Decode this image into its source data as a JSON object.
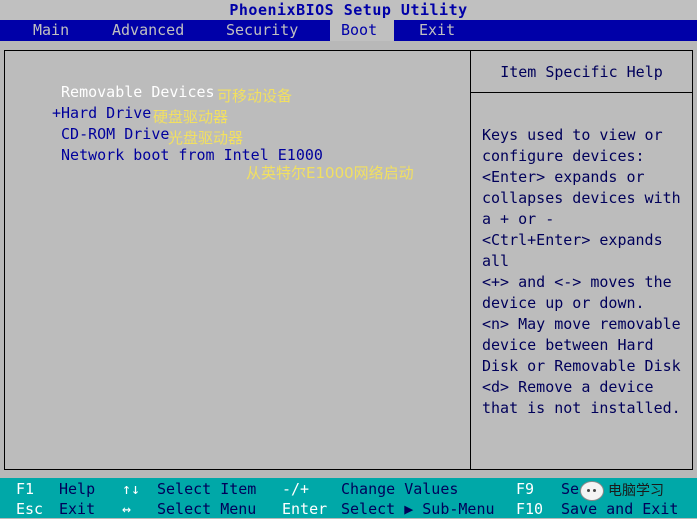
{
  "title": "PhoenixBIOS Setup Utility",
  "menu": [
    {
      "label": "Main"
    },
    {
      "label": "Advanced"
    },
    {
      "label": "Security"
    },
    {
      "label": "Boot"
    },
    {
      "label": "Exit"
    }
  ],
  "active_menu": "Boot",
  "boot_items": [
    {
      "label": " Removable Devices",
      "annotation": "可移动设备"
    },
    {
      "label": "+Hard Drive",
      "annotation": "硬盘驱动器"
    },
    {
      "label": " CD-ROM Drive",
      "annotation": "光盘驱动器"
    },
    {
      "label": " Network boot from Intel E1000",
      "annotation": "从英特尔E1000网络启动"
    }
  ],
  "help": {
    "title": "Item Specific Help",
    "lines": [
      "Keys used to view or",
      "configure devices:",
      "<Enter> expands or",
      "collapses devices with",
      "a + or -",
      "<Ctrl+Enter> expands",
      "all",
      "<+> and <-> moves the",
      "device up or down.",
      "<n> May move removable",
      "device between Hard",
      "Disk or Removable Disk",
      "<d> Remove a device",
      "that is not installed."
    ]
  },
  "status": {
    "row1": [
      {
        "key": "F1",
        "desc": "Help"
      },
      {
        "key": "↑↓",
        "desc": "Select Item"
      },
      {
        "key": "-/+",
        "desc": "Change Values"
      },
      {
        "key": "F9",
        "desc": "Se"
      }
    ],
    "row2": [
      {
        "key": "Esc",
        "desc": "Exit"
      },
      {
        "key": "↔",
        "desc": "Select Menu"
      },
      {
        "key": "Enter",
        "desc": "Select ▶ Sub-Menu"
      },
      {
        "key": "F10",
        "desc": "Save and Exit"
      }
    ]
  },
  "watermark": "电脑学习",
  "colors": {
    "menubar": "#0000a8",
    "statusbar": "#00a8a8",
    "panel": "#bcbcbc",
    "annotation": "#f2e060"
  }
}
